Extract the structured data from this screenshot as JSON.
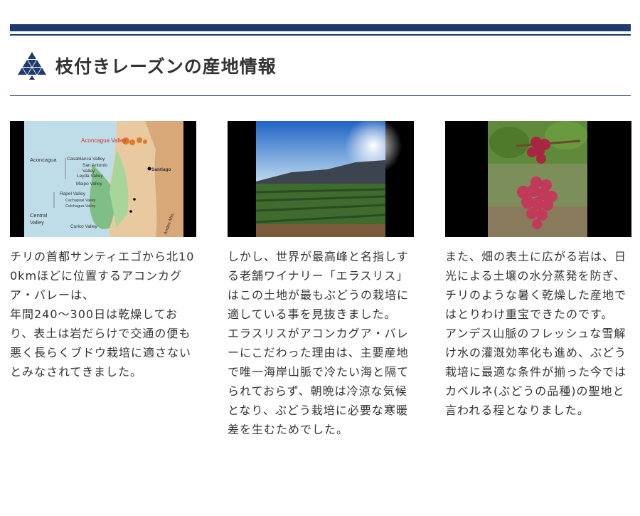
{
  "header": {
    "title": "枝付きレーズンの産地情報",
    "logo_icon": "triangle-lattice-logo-icon",
    "accent_color": "#1f3b6e"
  },
  "map": {
    "labels": {
      "aconcagua_valley": "Aconcagua Valley",
      "aconcagua": "Aconcagua",
      "casablanca": "Casablanca Valley",
      "san_antonio_1": "San Antonio",
      "san_antonio_2": "Valley",
      "leyda": "Leyda Valley",
      "santiago": "Santiago",
      "maipo": "Maipo Valley",
      "rapel": "Rapel Valley",
      "cachapoal": "Cachapoal Valley",
      "colchagua": "Colchagua Valley",
      "central_1": "Central",
      "central_2": "Valley",
      "curico": "Curico Valley",
      "andes": "Andes Mts."
    }
  },
  "columns": [
    {
      "image_icon": "chile-wine-region-map-image",
      "paragraphs": [
        "チリの首都サンティエゴから北100kmほどに位置するアコンカグア・バレーは、",
        "年間240〜300日は乾燥しており、表土は岩だらけで交通の便も悪く長らくブドウ栽培に適さないとみなされてきました。"
      ]
    },
    {
      "image_icon": "vineyard-photo-image",
      "paragraphs": [
        "しかし、世界が最高峰と名指しする老舗ワイナリー「エラスリス」はこの土地が最もぶどうの栽培に適している事を見抜きました。",
        "エラスリスがアコンカグア・バレーにこだわった理由は、主要産地で唯一海岸山脈で冷たい海と隔てられておらず、朝晩は冷涼な気候となり、ぶどう栽培に必要な寒暖差を生むためでした。"
      ]
    },
    {
      "image_icon": "red-grapes-photo-image",
      "paragraphs": [
        "また、畑の表土に広がる岩は、日光による土壌の水分蒸発を防ぎ、チリのような暑く乾燥した産地ではとりわけ重宝できたのです。",
        "アンデス山脈のフレッシュな雪解け水の灌漑効率化も進め、ぶどう栽培に最適な条件が揃った今ではカベルネ(ぶどうの品種)の聖地と言われる程となりました。"
      ]
    }
  ]
}
